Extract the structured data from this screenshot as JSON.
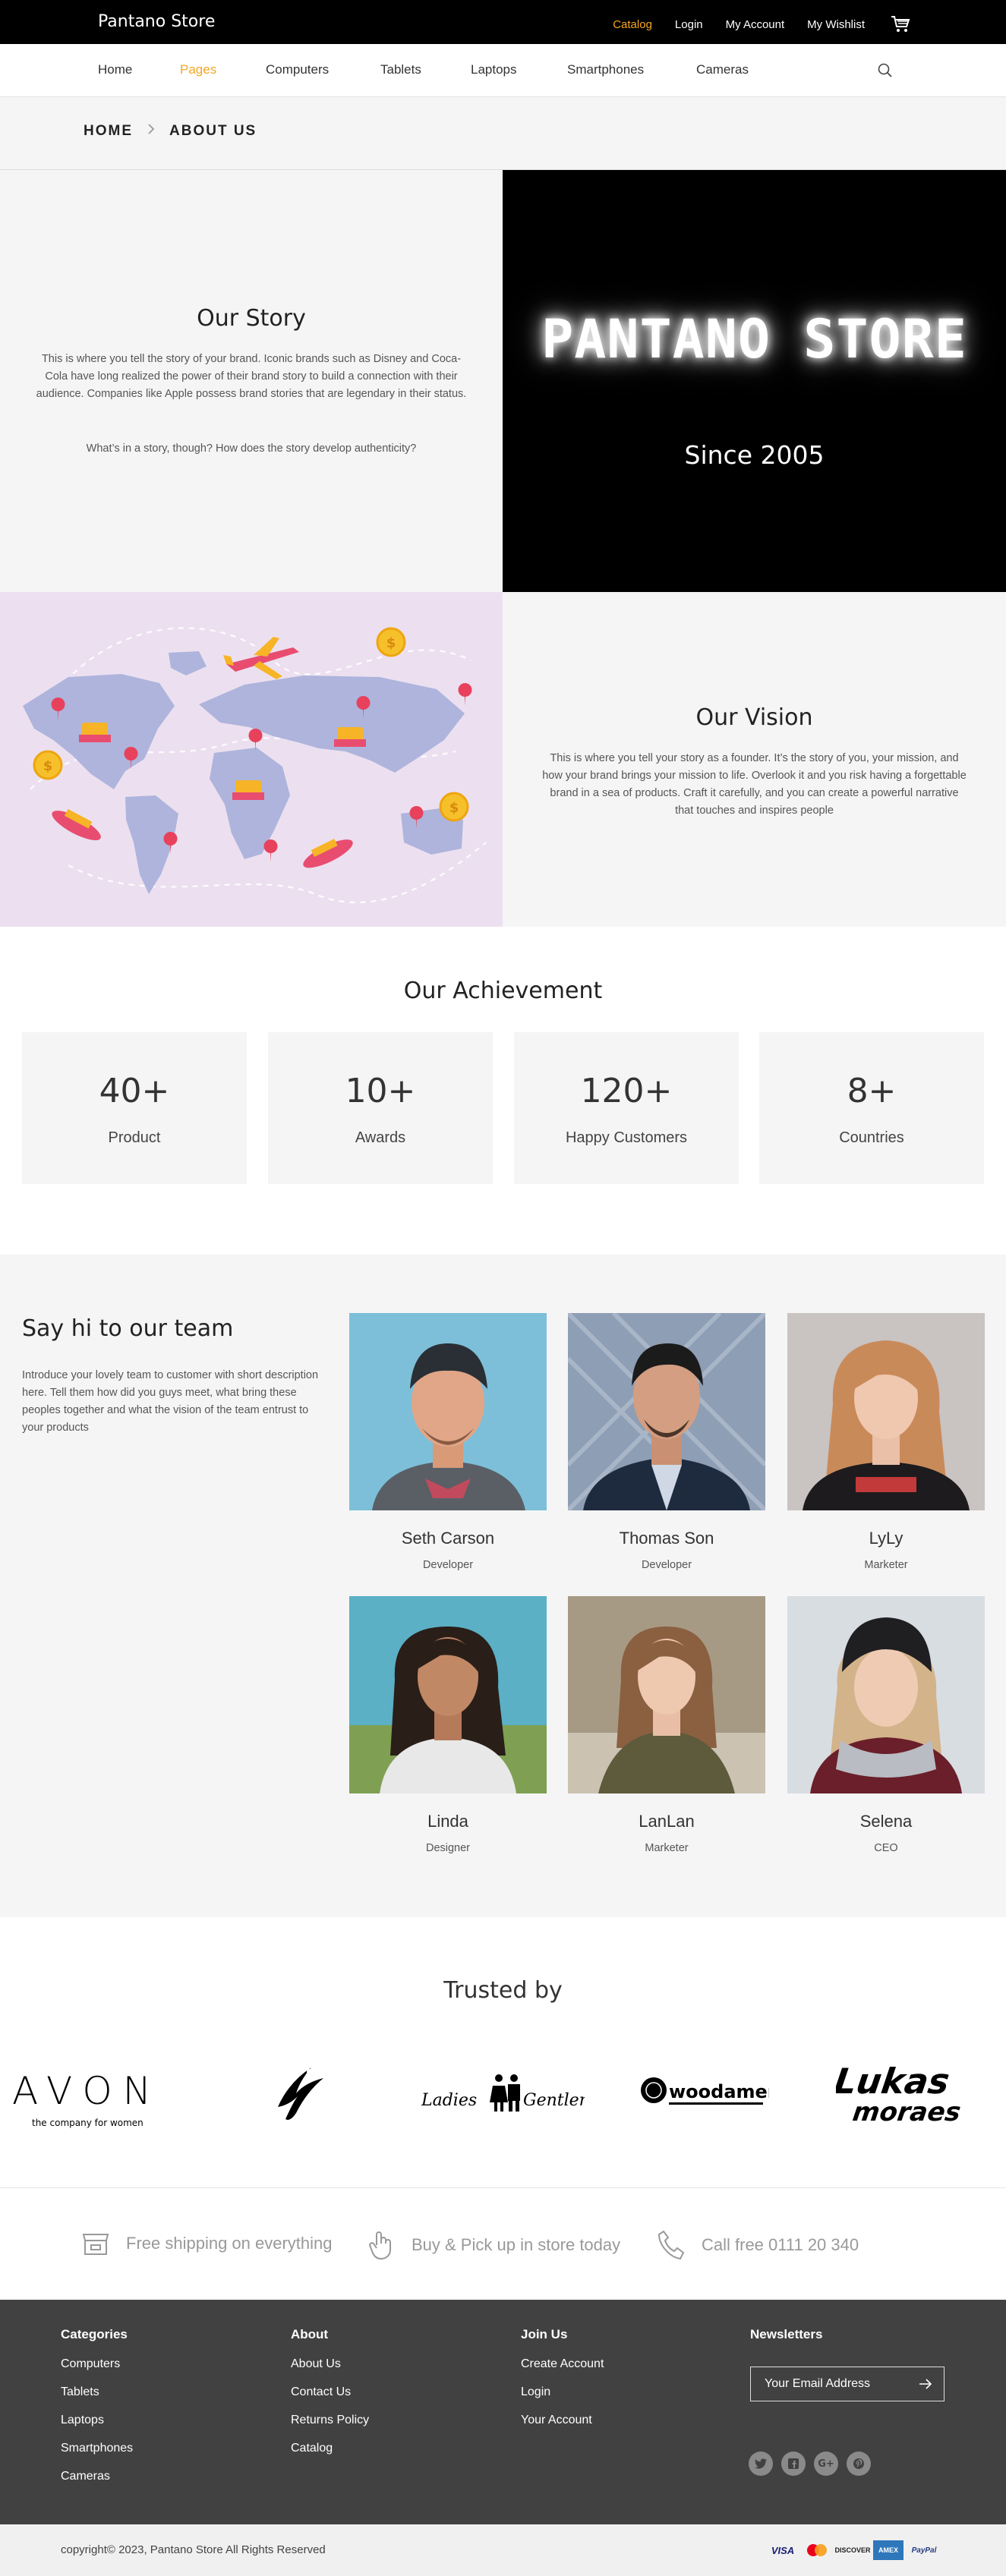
{
  "header": {
    "brand": "Pantano Store",
    "links": [
      "Catalog",
      "Login",
      "My Account",
      "My Wishlist"
    ],
    "active_link": "Catalog"
  },
  "nav": {
    "items": [
      "Home",
      "Pages",
      "Computers",
      "Tablets",
      "Laptops",
      "Smartphones",
      "Cameras"
    ],
    "active": "Pages"
  },
  "breadcrumb": {
    "home": "HOME",
    "current": "ABOUT US"
  },
  "story": {
    "title": "Our Story",
    "p1": "This is where you tell the story of your brand. Iconic brands such as Disney and Coca-Cola have long realized the power of their brand story to build a connection with their audience. Companies like Apple possess brand stories that are legendary in their status.",
    "p2": "What’s in a story, though? How does the story develop authenticity?",
    "neon": "PANTANO STORE",
    "since": "Since 2005"
  },
  "vision": {
    "title": "Our Vision",
    "text": "This is where you tell your story as a founder. It’s the story of you, your mission, and how your brand brings your mission to life. Overlook it and you risk having a forgettable brand in a sea of products. Craft it carefully, and you can create a powerful narrative that touches and inspires people"
  },
  "achievement": {
    "title": "Our Achievement",
    "stats": [
      {
        "value": "40+",
        "label": "Product"
      },
      {
        "value": "10+",
        "label": "Awards"
      },
      {
        "value": "120+",
        "label": "Happy Customers"
      },
      {
        "value": "8+",
        "label": "Countries"
      }
    ]
  },
  "team": {
    "title": "Say hi to our team",
    "description": "Introduce your lovely team to customer with short description here. Tell them how did you guys meet, what bring these peoples together and what the vision of the team entrust to your products",
    "members": [
      {
        "name": "Seth Carson",
        "role": "Developer"
      },
      {
        "name": "Thomas Son",
        "role": "Developer"
      },
      {
        "name": "LyLy",
        "role": "Marketer"
      },
      {
        "name": "Linda",
        "role": "Designer"
      },
      {
        "name": "LanLan",
        "role": "Marketer"
      },
      {
        "name": "Selena",
        "role": "CEO"
      }
    ]
  },
  "trusted": {
    "title": "Trusted by",
    "logos": [
      "AVON",
      "the company for women",
      "Ladies & Gentlemen",
      "woodamen",
      "Lukas moraes"
    ]
  },
  "features": [
    {
      "icon": "shop-icon",
      "text": "Free shipping on everything"
    },
    {
      "icon": "hand-icon",
      "text": "Buy & Pick up in store today"
    },
    {
      "icon": "phone-icon",
      "text": "Call free 0111 20 340"
    }
  ],
  "footer": {
    "categories": {
      "title": "Categories",
      "links": [
        "Computers",
        "Tablets",
        "Laptops",
        "Smartphones",
        "Cameras"
      ]
    },
    "about": {
      "title": "About",
      "links": [
        "About Us",
        "Contact Us",
        "Returns Policy",
        "Catalog"
      ]
    },
    "join": {
      "title": "Join Us",
      "links": [
        "Create Account",
        "Login",
        "Your Account"
      ]
    },
    "newsletter": {
      "title": "Newsletters",
      "placeholder": "Your Email Address"
    },
    "social": [
      "twitter-icon",
      "facebook-icon",
      "google-plus-icon",
      "pinterest-icon"
    ],
    "copyright": "copyright© 2023, Pantano Store All Rights Reserved",
    "payments": [
      "VISA",
      "mastercard",
      "DISCOVER",
      "AMEX",
      "PayPal"
    ]
  },
  "colors": {
    "accent": "#f5a623",
    "footer": "#414141",
    "panel": "#f5f5f5"
  }
}
